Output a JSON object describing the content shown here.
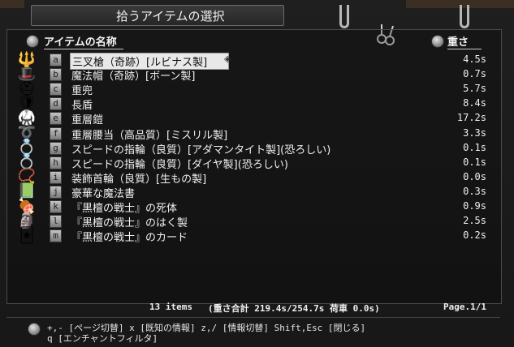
{
  "window": {
    "title": "拾うアイテムの選択"
  },
  "columns": {
    "name": "アイテムの名称",
    "weight": "重さ"
  },
  "items": [
    {
      "key": "a",
      "name": "三叉槍（奇跡）[ルビナス製]",
      "weight": "4.5s",
      "icon": "trident-icon",
      "icon_glyph": "🔱",
      "selected": true
    },
    {
      "key": "b",
      "name": "魔法帽（奇跡）[ボーン製]",
      "weight": "0.7s",
      "icon": "wizard-hat-icon",
      "icon_glyph": "🎩"
    },
    {
      "key": "c",
      "name": "重兜",
      "weight": "5.7s",
      "icon": "heavy-helmet-icon",
      "icon_glyph": "⛑"
    },
    {
      "key": "d",
      "name": "長盾",
      "weight": "8.4s",
      "icon": "long-shield-icon",
      "icon_glyph": "🛡"
    },
    {
      "key": "e",
      "name": "重層鎧",
      "weight": "17.2s",
      "icon": "plate-armor-icon",
      "icon_glyph": "🥋"
    },
    {
      "key": "f",
      "name": "重層腰当（高品質）[ミスリル製]",
      "weight": "3.3s",
      "icon": "girdle-icon",
      "icon_glyph": "➰"
    },
    {
      "key": "g",
      "name": "スピードの指輪（良質）[アダマンタイト製](恐ろしい)",
      "weight": "0.1s",
      "icon": "ring-icon",
      "icon_glyph": "💍"
    },
    {
      "key": "h",
      "name": "スピードの指輪（良質）[ダイヤ製](恐ろしい)",
      "weight": "0.1s",
      "icon": "ring-icon",
      "icon_glyph": "💍"
    },
    {
      "key": "i",
      "name": "装飾首輪（良質）[生もの製]",
      "weight": "0.0s",
      "icon": "amulet-icon",
      "icon_glyph": "📿"
    },
    {
      "key": "j",
      "name": "豪華な魔法書",
      "weight": "0.3s",
      "icon": "spellbook-icon",
      "icon_glyph": "📗"
    },
    {
      "key": "k",
      "name": "『黒檀の戦士』の死体",
      "weight": "0.9s",
      "icon": "corpse-icon",
      "icon_glyph": "🍖"
    },
    {
      "key": "l",
      "name": "『黒檀の戦士』のはく製",
      "weight": "2.5s",
      "icon": "stuffed-figure-icon",
      "icon_glyph": "🗿"
    },
    {
      "key": "m",
      "name": "『黒檀の戦士』のカード",
      "weight": "0.2s",
      "icon": "card-icon",
      "icon_glyph": "🃏"
    }
  ],
  "status": {
    "count": "13 items",
    "weight_summary": "(重さ合計 219.4s/254.7s  荷車 0.0s)",
    "page": "Page.1/1"
  },
  "help": {
    "line1": "+,- [ページ切替]  x [既知の情報]  z,/ [情報切替]  Shift,Esc [閉じる]",
    "line2": "q [エンチャントフィルタ]"
  },
  "colors": {
    "selected_bg": "#e8e8e8",
    "text": "#f0f0f0",
    "panel_border": "#4a4a4a"
  }
}
